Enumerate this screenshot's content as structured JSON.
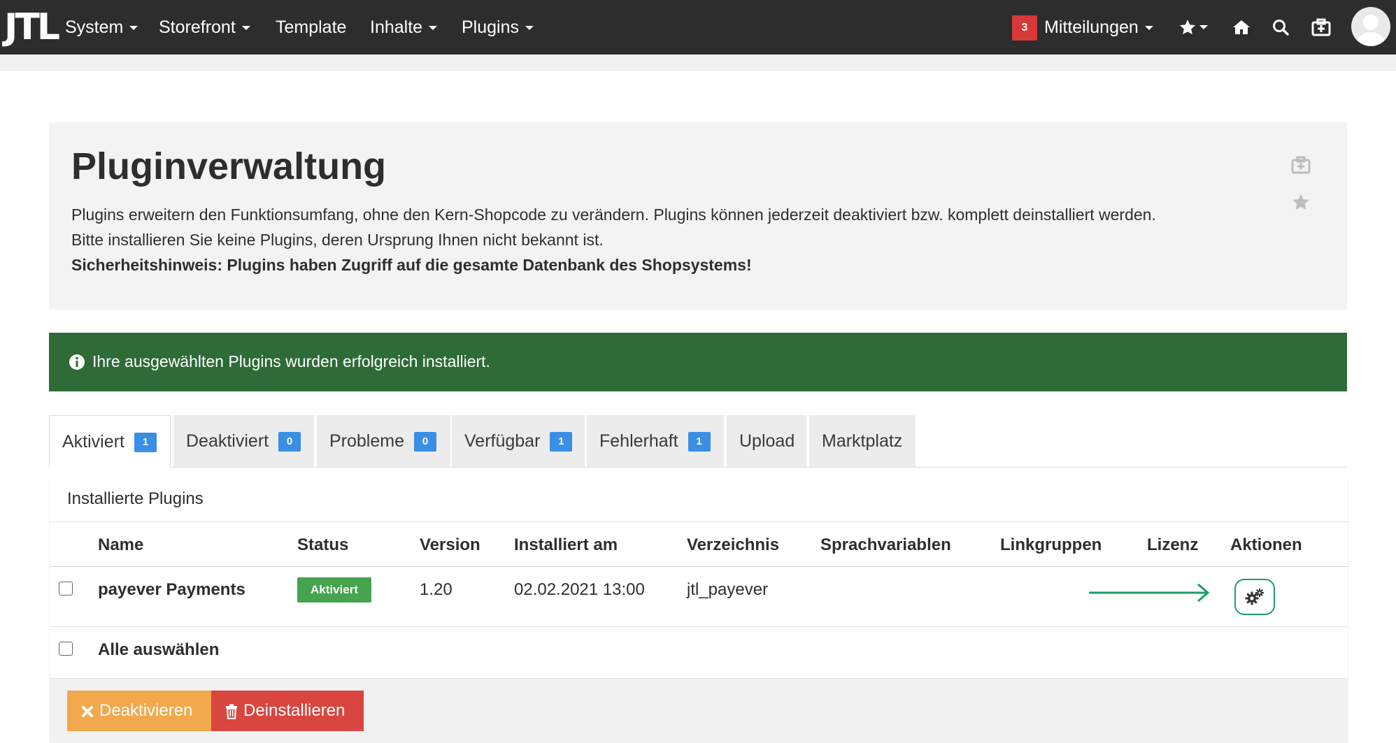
{
  "nav": {
    "logo": "JTL",
    "items": [
      {
        "label": "System"
      },
      {
        "label": "Storefront"
      },
      {
        "label": "Template"
      },
      {
        "label": "Inhalte"
      },
      {
        "label": "Plugins"
      }
    ],
    "notifications_count": "3",
    "notifications_label": "Mitteilungen",
    "icons": [
      "star-icon",
      "home-icon",
      "search-icon",
      "medkit-icon",
      "avatar"
    ]
  },
  "header": {
    "title": "Pluginverwaltung",
    "description": "Plugins erweitern den Funktionsumfang, ohne den Kern-Shopcode zu verändern. Plugins können jederzeit deaktiviert bzw. komplett deinstalliert werden. Bitte installieren Sie keine Plugins, deren Ursprung Ihnen nicht bekannt ist.",
    "security_note": "Sicherheitshinweis: Plugins haben Zugriff auf die gesamte Datenbank des Shopsystems!"
  },
  "alert": {
    "message": "Ihre ausgewählten Plugins wurden erfolgreich installiert.",
    "color": "#2e6b37"
  },
  "tabs": [
    {
      "label": "Aktiviert",
      "count": "1"
    },
    {
      "label": "Deaktiviert",
      "count": "0"
    },
    {
      "label": "Probleme",
      "count": "0"
    },
    {
      "label": "Verfügbar",
      "count": "1"
    },
    {
      "label": "Fehlerhaft",
      "count": "1"
    },
    {
      "label": "Upload"
    },
    {
      "label": "Marktplatz"
    }
  ],
  "table": {
    "heading": "Installierte Plugins",
    "columns": [
      "Name",
      "Status",
      "Version",
      "Installiert am",
      "Verzeichnis",
      "Sprachvariablen",
      "Linkgruppen",
      "Lizenz",
      "Aktionen"
    ],
    "rows": [
      {
        "name": "payever Payments",
        "status": "Aktiviert",
        "version": "1.20",
        "installed": "02.02.2021 13:00",
        "directory": "jtl_payever",
        "language_vars": "",
        "link_groups": "",
        "license": ""
      }
    ],
    "select_all": "Alle auswählen"
  },
  "buttons": {
    "deactivate": "Deaktivieren",
    "uninstall": "Deinstallieren"
  },
  "colors": {
    "topbar": "#2d2d2d",
    "alert": "#2e6b37",
    "count_badge": "#3a8ee6",
    "status_active": "#45a44d",
    "btn_warning": "#f2a84c",
    "btn_danger": "#d9453f",
    "annotation": "#1aa067"
  }
}
